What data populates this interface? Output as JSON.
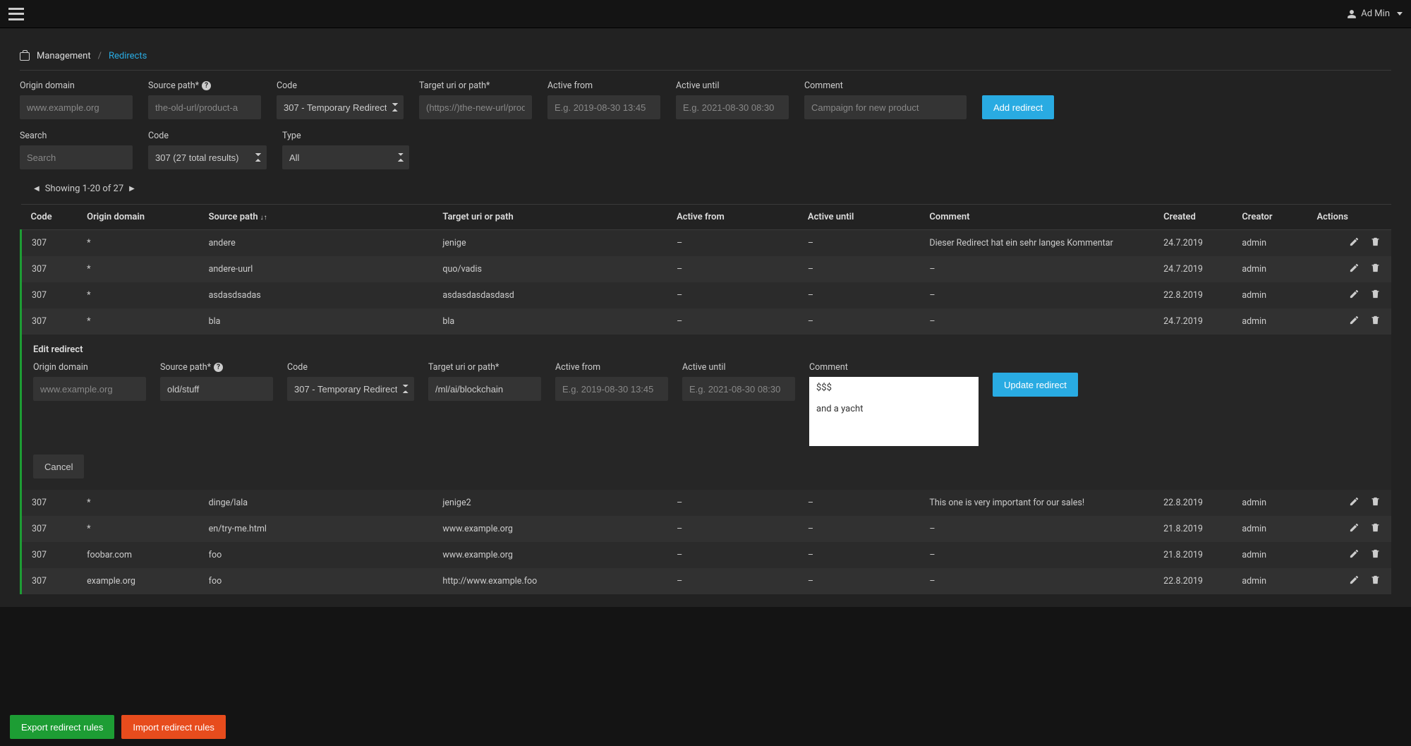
{
  "topbar": {
    "user_name": "Ad Min"
  },
  "breadcrumb": {
    "root": "Management",
    "current": "Redirects"
  },
  "add_form": {
    "labels": {
      "origin": "Origin domain",
      "source": "Source path*",
      "code": "Code",
      "target": "Target uri or path*",
      "active_from": "Active from",
      "active_until": "Active until",
      "comment": "Comment"
    },
    "placeholders": {
      "origin": "www.example.org",
      "source": "the-old-url/product-a",
      "target": "(https://)the-new-url/product-a",
      "active_from": "E.g. 2019-08-30 13:45",
      "active_until": "E.g. 2021-08-30 08:30",
      "comment": "Campaign for new product"
    },
    "code_option": "307 - Temporary Redirect",
    "submit": "Add redirect"
  },
  "filter": {
    "labels": {
      "search": "Search",
      "code": "Code",
      "type": "Type"
    },
    "placeholders": {
      "search": "Search"
    },
    "code_option": "307 (27 total results)",
    "type_option": "All"
  },
  "pager": {
    "text": "Showing 1-20 of 27"
  },
  "columns": {
    "code": "Code",
    "origin": "Origin domain",
    "source": "Source path",
    "target": "Target uri or path",
    "active_from": "Active from",
    "active_until": "Active until",
    "comment": "Comment",
    "created": "Created",
    "creator": "Creator",
    "actions": "Actions"
  },
  "rows_top": [
    {
      "code": "307",
      "origin": "*",
      "source": "andere",
      "target": "jenige",
      "af": "–",
      "au": "–",
      "comment": "Dieser Redirect hat ein sehr langes Kommentar",
      "created": "24.7.2019",
      "creator": "admin"
    },
    {
      "code": "307",
      "origin": "*",
      "source": "andere-uurl",
      "target": "quo/vadis",
      "af": "–",
      "au": "–",
      "comment": "–",
      "created": "24.7.2019",
      "creator": "admin"
    },
    {
      "code": "307",
      "origin": "*",
      "source": "asdasdsadas",
      "target": "asdasdasdasdasd",
      "af": "–",
      "au": "–",
      "comment": "–",
      "created": "22.8.2019",
      "creator": "admin"
    },
    {
      "code": "307",
      "origin": "*",
      "source": "bla",
      "target": "bla",
      "af": "–",
      "au": "–",
      "comment": "–",
      "created": "24.7.2019",
      "creator": "admin"
    }
  ],
  "rows_bottom": [
    {
      "code": "307",
      "origin": "*",
      "source": "dinge/lala",
      "target": "jenige2",
      "af": "–",
      "au": "–",
      "comment": "This one is very important for our sales!",
      "created": "22.8.2019",
      "creator": "admin"
    },
    {
      "code": "307",
      "origin": "*",
      "source": "en/try-me.html",
      "target": "www.example.org",
      "af": "–",
      "au": "–",
      "comment": "–",
      "created": "21.8.2019",
      "creator": "admin"
    },
    {
      "code": "307",
      "origin": "foobar.com",
      "source": "foo",
      "target": "www.example.org",
      "af": "–",
      "au": "–",
      "comment": "–",
      "created": "21.8.2019",
      "creator": "admin"
    },
    {
      "code": "307",
      "origin": "example.org",
      "source": "foo",
      "target": "http://www.example.foo",
      "af": "–",
      "au": "–",
      "comment": "–",
      "created": "22.8.2019",
      "creator": "admin"
    }
  ],
  "edit": {
    "title": "Edit redirect",
    "labels": {
      "origin": "Origin domain",
      "source": "Source path*",
      "code": "Code",
      "target": "Target uri or path*",
      "active_from": "Active from",
      "active_until": "Active until",
      "comment": "Comment"
    },
    "placeholders": {
      "origin": "www.example.org",
      "active_from": "E.g. 2019-08-30 13:45",
      "active_until": "E.g. 2021-08-30 08:30"
    },
    "values": {
      "source": "old/stuff",
      "code": "307 - Temporary Redirect",
      "target": "/ml/ai/blockchain",
      "comment": "$$$\n\nand a yacht"
    },
    "submit": "Update redirect",
    "cancel": "Cancel"
  },
  "footer": {
    "export": "Export redirect rules",
    "import": "Import redirect rules"
  }
}
